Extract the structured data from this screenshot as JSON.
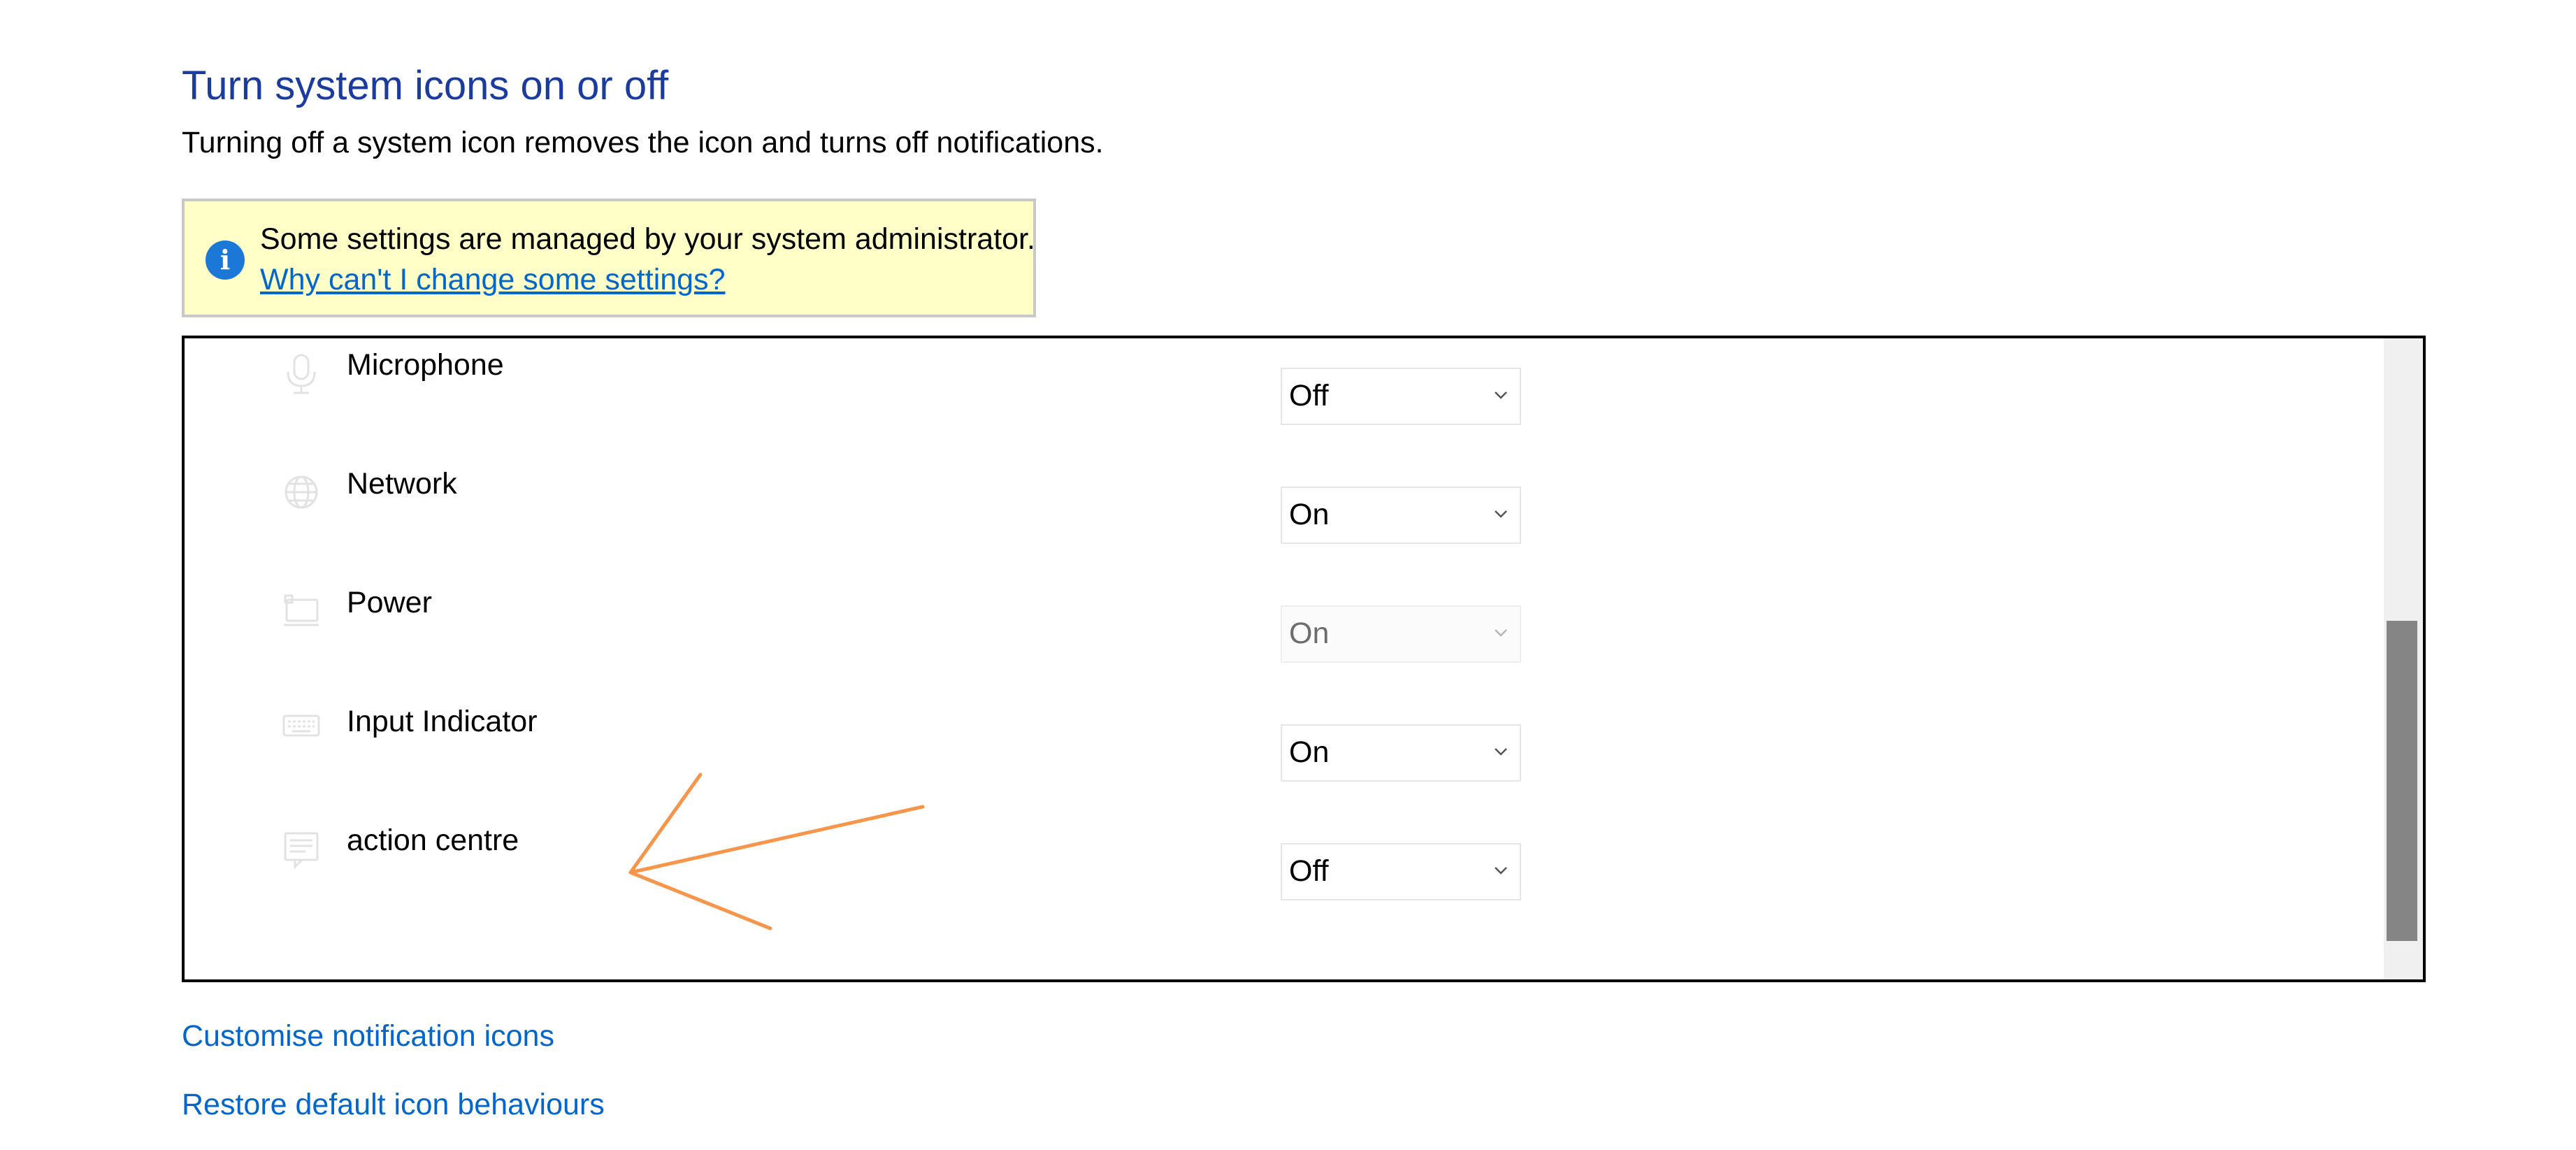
{
  "page": {
    "title": "Turn system icons on or off",
    "description": "Turning off a system icon removes the icon and turns off notifications."
  },
  "admin_banner": {
    "message": "Some settings are managed by your system administrator.",
    "link": "Why can't I change some settings?",
    "icon": "info-icon"
  },
  "system_icons": [
    {
      "label": "Microphone",
      "icon": "microphone-icon",
      "value": "Off",
      "enabled": true
    },
    {
      "label": "Network",
      "icon": "network-icon",
      "value": "On",
      "enabled": true
    },
    {
      "label": "Power",
      "icon": "power-icon",
      "value": "On",
      "enabled": false
    },
    {
      "label": "Input Indicator",
      "icon": "keyboard-icon",
      "value": "On",
      "enabled": true
    },
    {
      "label": "action centre",
      "icon": "action-centre-icon",
      "value": "Off",
      "enabled": true
    }
  ],
  "links": {
    "customise": "Customise notification icons",
    "restore": "Restore default icon behaviours"
  },
  "colors": {
    "title": "#1b3c9e",
    "link": "#0066cc",
    "banner_background": "#ffffc8",
    "info_icon": "#1b78d6",
    "annotation": "#f7954a",
    "scroll_thumb": "#858585"
  }
}
